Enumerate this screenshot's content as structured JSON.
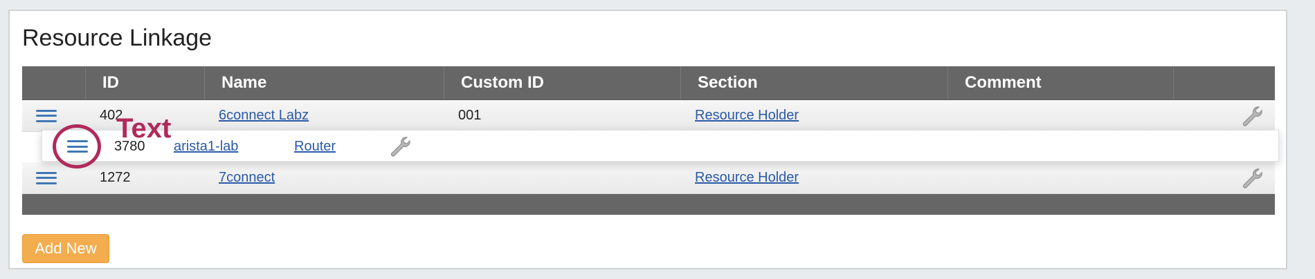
{
  "panel": {
    "title": "Resource Linkage"
  },
  "table": {
    "columns": [
      "",
      "ID",
      "Name",
      "Custom ID",
      "Section",
      "Comment",
      ""
    ],
    "rows": [
      {
        "id": "402",
        "name": "6connect Labz",
        "custom_id": "001",
        "section": "Resource Holder",
        "comment": ""
      },
      {
        "id": "1272",
        "name": "7connect",
        "custom_id": "",
        "section": "Resource Holder",
        "comment": ""
      }
    ]
  },
  "dragged_row": {
    "id": "3780",
    "name": "arista1-lab",
    "section": "Router"
  },
  "annotation": {
    "label": "Text",
    "color": "#b02a5b"
  },
  "actions": {
    "add_new_label": "Add New"
  },
  "icons": {
    "row_handle": "hamburger-drag-icon",
    "row_action": "wrench-icon"
  },
  "colors": {
    "header_bg": "#666666",
    "link": "#2a5aa8",
    "add_button": "#f3ad4e",
    "handle": "#3f78b4"
  }
}
